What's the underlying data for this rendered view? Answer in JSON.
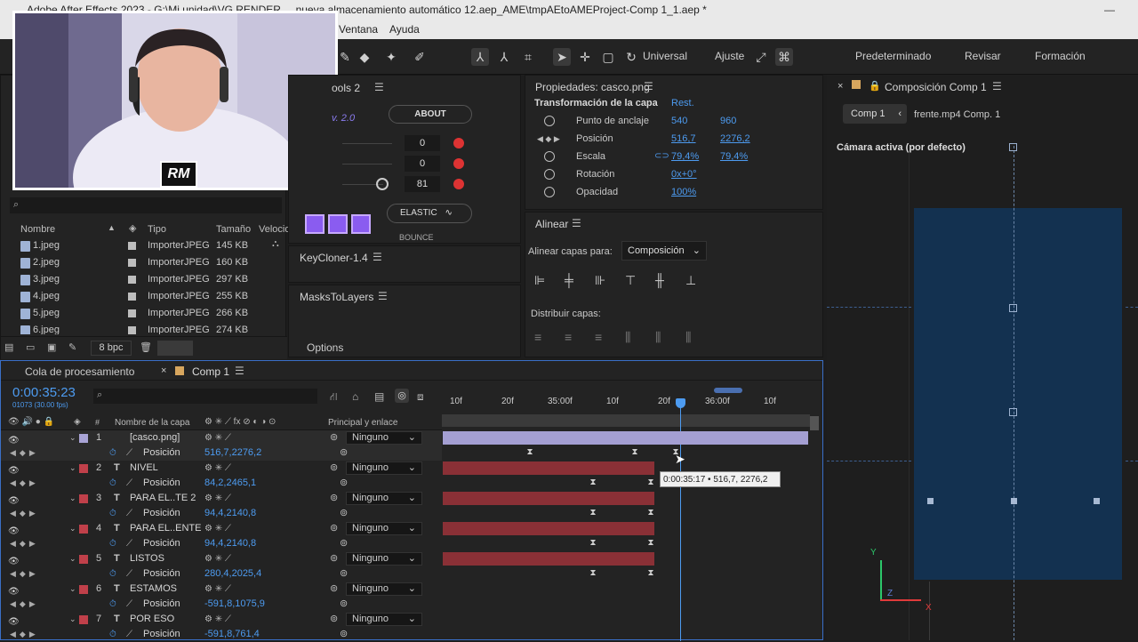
{
  "window": {
    "title": "Adobe After Effects 2023 - G:\\Mi unidad\\VG RENDER ... nueva almacenamiento automático 12.aep_AME\\tmpAEtoAMEProject-Comp 1_1.aep *",
    "minimize_glyph": "—"
  },
  "menu": {
    "items": [
      "Ventana",
      "Ayuda"
    ]
  },
  "toolbar": {
    "mode_label": "Universal",
    "snap_label": "Ajuste",
    "workspaces": [
      "Predeterminado",
      "Revisar",
      "Formación"
    ]
  },
  "webcam": {
    "logo_text": "RM"
  },
  "project": {
    "search_placeholder": "",
    "columns": {
      "name": "Nombre",
      "type": "Tipo",
      "size": "Tamaño",
      "speed": "Velocid"
    },
    "files": [
      {
        "name": "1.jpeg",
        "type": "ImporterJPEG",
        "size": "145 KB"
      },
      {
        "name": "2.jpeg",
        "type": "ImporterJPEG",
        "size": "160 KB"
      },
      {
        "name": "3.jpeg",
        "type": "ImporterJPEG",
        "size": "297 KB"
      },
      {
        "name": "4.jpeg",
        "type": "ImporterJPEG",
        "size": "255 KB"
      },
      {
        "name": "5.jpeg",
        "type": "ImporterJPEG",
        "size": "266 KB"
      },
      {
        "name": "6.jpeg",
        "type": "ImporterJPEG",
        "size": "274 KB"
      }
    ],
    "bpc": "8 bpc"
  },
  "tools2": {
    "title": "ools 2",
    "version": "v. 2.0",
    "about": "ABOUT",
    "values": [
      "0",
      "0",
      "81"
    ],
    "elastic": "ELASTIC",
    "bounce": "BOUNCE"
  },
  "keycloner": {
    "title": "KeyCloner-1.4"
  },
  "maskstolayers": {
    "title": "MasksToLayers",
    "options": "Options"
  },
  "properties": {
    "title": "Propiedades: casco.png",
    "section": "Transformación de la capa",
    "reset": "Rest.",
    "rows": [
      {
        "name": "Punto de anclaje",
        "v1": "540",
        "v2": "960"
      },
      {
        "name": "Posición",
        "v1": "516,7",
        "v2": "2276,2"
      },
      {
        "name": "Escala",
        "v1": "79,4%",
        "v2": "79,4%"
      },
      {
        "name": "Rotación",
        "v1": "0x+0°",
        "v2": ""
      },
      {
        "name": "Opacidad",
        "v1": "100%",
        "v2": ""
      }
    ]
  },
  "align": {
    "title": "Alinear",
    "align_to_label": "Alinear capas para:",
    "align_to_value": "Composición",
    "distribute_label": "Distribuir capas:"
  },
  "composition": {
    "close": "×",
    "title": "Composición Comp 1",
    "tab_active": "Comp 1",
    "tab_other": "frente.mp4 Comp. 1",
    "camera": "Cámara activa (por defecto)",
    "axis_y": "Y",
    "axis_z": "Z",
    "axis_x": "X"
  },
  "timeline": {
    "render_queue": "Cola de procesamiento",
    "close": "×",
    "comp_tab": "Comp 1",
    "timecode": "0:00:35:23",
    "frames": "01073 (30.00 fps)",
    "col_name": "Nombre de la capa",
    "col_parent": "Principal y enlace",
    "ruler": [
      "10f",
      "20f",
      "35:00f",
      "10f",
      "20f",
      "36:00f",
      "10f"
    ],
    "tooltip": "0:00:35:17 • 516,7, 2276,2",
    "layers": [
      {
        "index": "1",
        "type": "",
        "name": "[casco.png]",
        "parent": "Ninguno",
        "prop": "Posición",
        "value": "516,7,2276,2",
        "color": "#a9a4d6"
      },
      {
        "index": "2",
        "type": "T",
        "name": "NIVEL",
        "parent": "Ninguno",
        "prop": "Posición",
        "value": "84,2,2465,1",
        "color": "#c0404a"
      },
      {
        "index": "3",
        "type": "T",
        "name": "PARA EL..TE 2",
        "parent": "Ninguno",
        "prop": "Posición",
        "value": "94,4,2140,8",
        "color": "#c0404a"
      },
      {
        "index": "4",
        "type": "T",
        "name": "PARA EL..ENTE",
        "parent": "Ninguno",
        "prop": "Posición",
        "value": "94,4,2140,8",
        "color": "#c0404a"
      },
      {
        "index": "5",
        "type": "T",
        "name": "LISTOS",
        "parent": "Ninguno",
        "prop": "Posición",
        "value": "280,4,2025,4",
        "color": "#c0404a"
      },
      {
        "index": "6",
        "type": "T",
        "name": "ESTAMOS",
        "parent": "Ninguno",
        "prop": "Posición",
        "value": "-591,8,1075,9",
        "color": "#c0404a"
      },
      {
        "index": "7",
        "type": "T",
        "name": "POR ESO",
        "parent": "Ninguno",
        "prop": "Posición",
        "value": "-591,8,761,4",
        "color": "#c0404a"
      }
    ]
  }
}
